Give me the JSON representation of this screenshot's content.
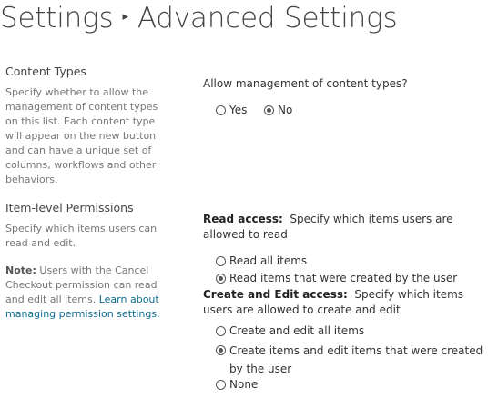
{
  "breadcrumb": {
    "parent": "Settings",
    "separator": "▸",
    "current": "Advanced Settings"
  },
  "content_types": {
    "title": "Content Types",
    "description": "Specify whether to allow the management of content types on this list. Each content type will appear on the new button and can have a unique set of columns, workflows and other behaviors.",
    "question": "Allow management of content types?",
    "options": [
      {
        "label": "Yes",
        "checked": false
      },
      {
        "label": "No",
        "checked": true
      }
    ]
  },
  "item_permissions": {
    "title": "Item-level Permissions",
    "description": "Specify which items users can read and edit.",
    "note_label": "Note:",
    "note_text": " Users with the Cancel Checkout permission can read and edit all items. ",
    "link_text": "Learn about managing permission settings.",
    "read_access": {
      "label": "Read access:",
      "text": "  Specify which items users are allowed to read",
      "options": [
        {
          "label": "Read all items",
          "checked": false
        },
        {
          "label": "Read items that were created by the user",
          "checked": true
        }
      ]
    },
    "edit_access": {
      "label": "Create and Edit access:",
      "text": "  Specify which items users are allowed to create and edit",
      "options": [
        {
          "label": "Create and edit all items",
          "checked": false
        },
        {
          "label": "Create items and edit items that were created by the user",
          "checked": true
        },
        {
          "label": "None",
          "checked": false
        }
      ]
    }
  },
  "colors": {
    "title_text": "#444444",
    "description_text": "#777777",
    "link": "#0f6b8f",
    "radio_border": "#555555"
  }
}
